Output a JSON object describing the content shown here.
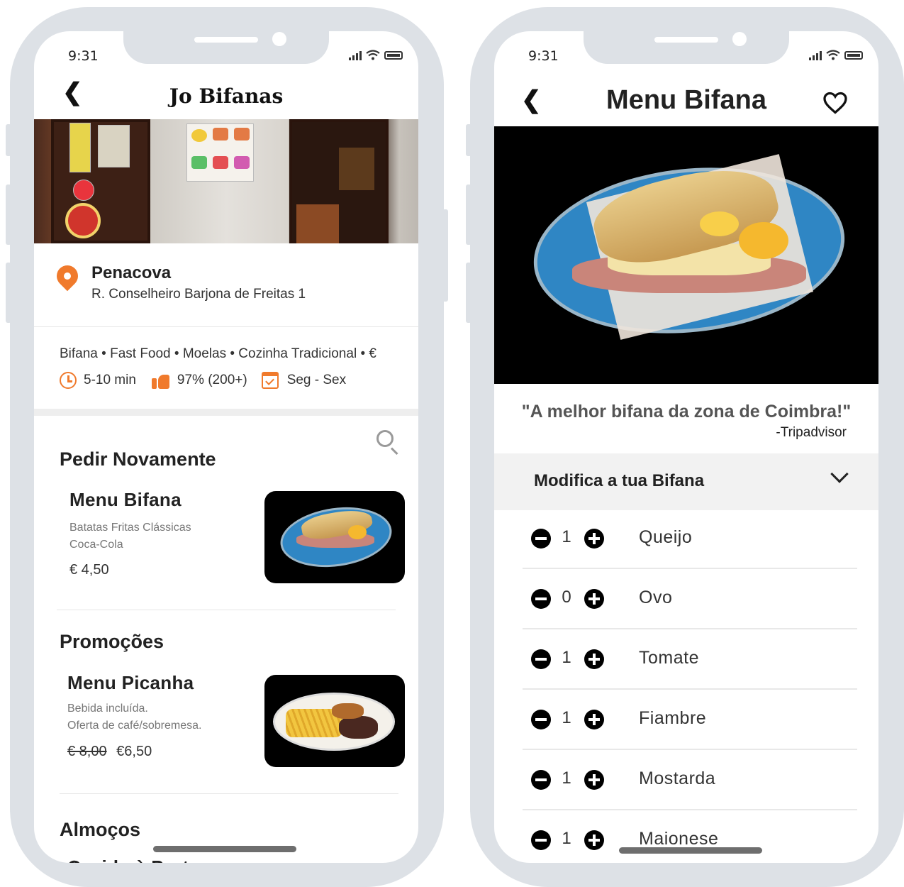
{
  "left_screen": {
    "status_time": "9:31",
    "header": {
      "title": "Jo Bifanas"
    },
    "location": {
      "name": "Penacova",
      "address": "R. Conselheiro Barjona de Freitas 1"
    },
    "tags": "Bifana • Fast Food • Moelas • Cozinha Tradicional • €",
    "meta": {
      "time": "5-10 min",
      "rating": "97% (200+)",
      "days": "Seg - Sex"
    },
    "sections": [
      {
        "title": "Pedir Novamente",
        "item": {
          "name": "Menu Bifana",
          "desc1": "Batatas Fritas Clássicas",
          "desc2": "Coca-Cola",
          "price": "€ 4,50"
        }
      },
      {
        "title": "Promoções",
        "item": {
          "name": "Menu Picanha",
          "desc1": "Bebida incluída.",
          "desc2": "Oferta de café/sobremesa.",
          "old_price": "€ 8,00",
          "price": "€6,50"
        }
      },
      {
        "title": "Almoços",
        "item": {
          "name": "Cozido à Portuguesa"
        }
      }
    ]
  },
  "right_screen": {
    "status_time": "9:31",
    "header": {
      "title": "Menu Bifana"
    },
    "quote": "\"A melhor bifana da zona de Coimbra!\"",
    "quote_source": "-Tripadvisor",
    "modify_label": "Modifica a tua Bifana",
    "ingredients": [
      {
        "name": "Queijo",
        "qty": "1"
      },
      {
        "name": "Ovo",
        "qty": "0"
      },
      {
        "name": "Tomate",
        "qty": "1"
      },
      {
        "name": "Fiambre",
        "qty": "1"
      },
      {
        "name": "Mostarda",
        "qty": "1"
      },
      {
        "name": "Maionese",
        "qty": "1"
      }
    ]
  },
  "colors": {
    "accent": "#f07a2c",
    "frame": "#dde1e6"
  },
  "icons": [
    "back-icon",
    "location-pin-icon",
    "clock-icon",
    "thumbs-up-icon",
    "calendar-check-icon",
    "search-icon",
    "heart-icon",
    "chevron-down-icon",
    "minus-icon",
    "plus-icon"
  ]
}
